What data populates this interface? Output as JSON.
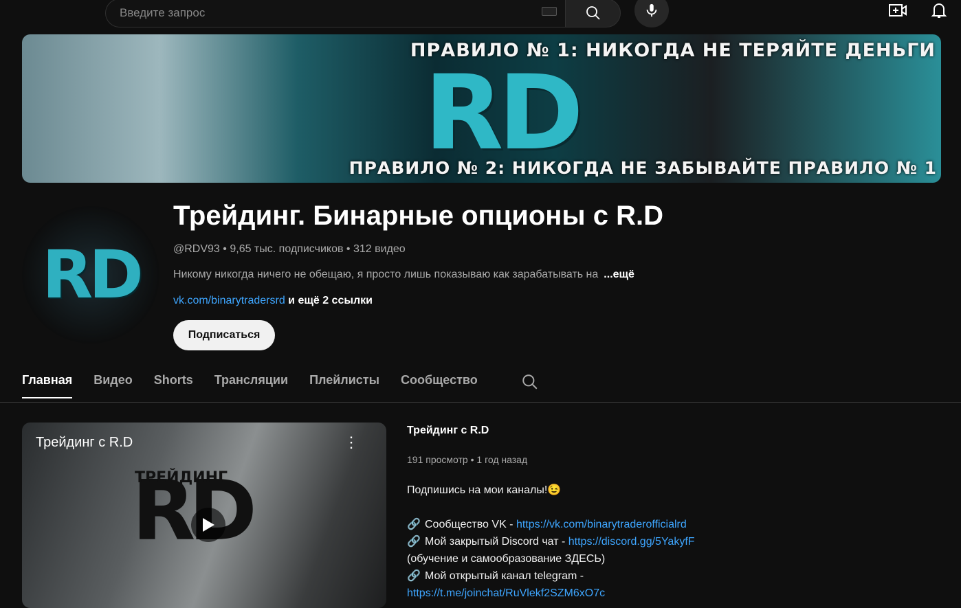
{
  "topbar": {
    "search_placeholder": "Введите запрос"
  },
  "banner": {
    "rule1": "ПРАВИЛО № 1: НИКОГДА НЕ ТЕРЯЙТЕ ДЕНЬГИ",
    "rule2": "ПРАВИЛО № 2: НИКОГДА НЕ ЗАБЫВАЙТЕ ПРАВИЛО № 1",
    "logo": "RD"
  },
  "channel": {
    "avatar_logo": "RD",
    "title": "Трейдинг. Бинарные опционы с R.D",
    "handle": "@RDV93",
    "subscribers": "9,65 тыс. подписчиков",
    "videos": "312 видео",
    "sep": "•",
    "description": "Никому никогда ничего не обещаю, я просто лишь показываю как зарабатывать на",
    "more": "...ещё",
    "link": "vk.com/binarytradersrd",
    "more_links": "и ещё 2 ссылки",
    "subscribe": "Подписаться"
  },
  "tabs": [
    "Главная",
    "Видео",
    "Shorts",
    "Трансляции",
    "Плейлисты",
    "Сообщество"
  ],
  "featured": {
    "thumb_title": "Трейдинг с R.D",
    "thumb_logo_small": "ТРЕЙДИНГ",
    "thumb_logo": "RD",
    "title": "Трейдинг с R.D",
    "views": "191 просмотр",
    "age": "1 год назад",
    "line1": "Подпишись на мои каналы!😉",
    "links": [
      {
        "label": "Сообщество VK - ",
        "url": "https://vk.com/binarytraderofficialrd"
      },
      {
        "label": "Мой закрытый Discord чат  - ",
        "url": "https://discord.gg/5YakyfF"
      }
    ],
    "line_note": "(обучение и самообразование ЗДЕСЬ)",
    "tg_label": "Мой открытый канал telegram -",
    "tg_url": "https://t.me/joinchat/RuVlekf2SZM6xO7c"
  }
}
